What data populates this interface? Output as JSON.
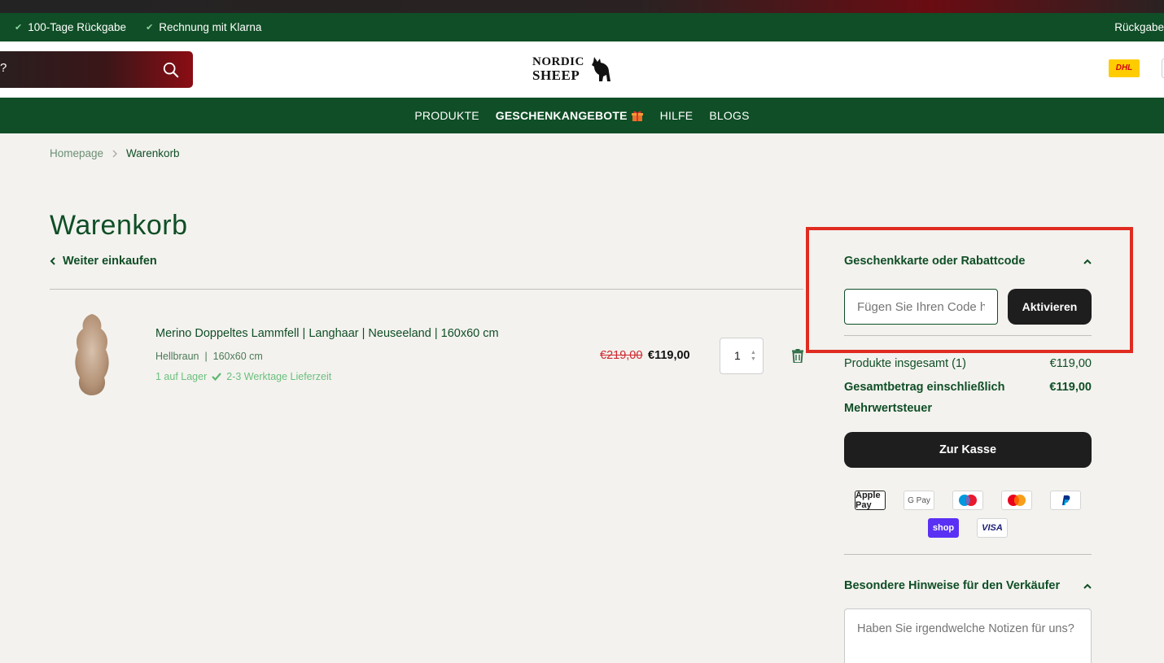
{
  "usp_bar": {
    "items": [
      "100-Tage Rückgabe",
      "Rechnung mit Klarna"
    ],
    "right_text": "Rückgabe"
  },
  "header": {
    "search_fragment": "?",
    "logo_line1": "NORDIC",
    "logo_line2": "SHEEP",
    "dhl_label": "DHL"
  },
  "nav": {
    "items": [
      {
        "label": "PRODUKTE"
      },
      {
        "label": "GESCHENKANGEBOTE"
      },
      {
        "label": "HILFE"
      },
      {
        "label": "BLOGS"
      }
    ]
  },
  "breadcrumb": {
    "home": "Homepage",
    "current": "Warenkorb"
  },
  "cart": {
    "title": "Warenkorb",
    "continue_label": "Weiter einkaufen",
    "item": {
      "name": "Merino Doppeltes Lammfell | Langhaar | Neuseeland | 160x60 cm",
      "variant": "Hellbraun  |  160x60 cm",
      "stock": "1 auf Lager",
      "delivery": "2-3 Werktage Lieferzeit",
      "old_price": "€219,00",
      "price": "€119,00",
      "quantity": "1"
    }
  },
  "summary": {
    "discount_title": "Geschenkkarte oder Rabattcode",
    "code_placeholder": "Fügen Sie Ihren Code hier ein",
    "activate_label": "Aktivieren",
    "products_total_label": "Produkte insgesamt (1)",
    "products_total_value": "€119,00",
    "grand_total_label": "Gesamtbetrag einschließlich Mehrwertsteuer",
    "grand_total_value": "€119,00",
    "checkout_label": "Zur Kasse",
    "payment_methods": [
      "Apple Pay",
      "G Pay",
      "Maestro",
      "Mastercard",
      "PayPal",
      "shop",
      "VISA"
    ],
    "notes_title": "Besondere Hinweise für den Verkäufer",
    "notes_placeholder": "Haben Sie irgendwelche Notizen für uns?"
  },
  "colors": {
    "brand_green": "#0f4e26",
    "highlight_red": "#e02b20",
    "sale_red": "#d0262d",
    "button_dark": "#1e1e1e"
  }
}
